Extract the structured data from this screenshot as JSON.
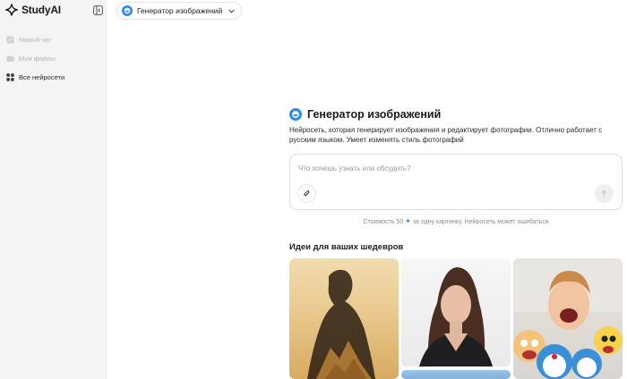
{
  "app": {
    "name": "StudyAI"
  },
  "sidebar": {
    "items": [
      {
        "label": "Новый чат",
        "icon": "edit-icon",
        "state": "disabled"
      },
      {
        "label": "Мои файлы",
        "icon": "folder-icon",
        "state": "disabled"
      },
      {
        "label": "Все нейросети",
        "icon": "grid-icon",
        "state": "active"
      }
    ]
  },
  "model_selector": {
    "label": "Генератор изображений",
    "icon": "image-generator-icon"
  },
  "main": {
    "title": "Генератор изображений",
    "description": "Нейросеть, которая генерирует изображения и редактирует фотографии. Отлично работает с русским языком. Умеет изменять стиль фотографий",
    "input": {
      "placeholder": "Что хочешь узнать или обсудить?"
    },
    "note_before": "Стоимость 50",
    "note_after": "за одну картинку. Нейросеть может ошибаться",
    "ideas_title": "Идеи для ваших шедевров"
  },
  "colors": {
    "accent": "#2c8cf0",
    "sidebar_bg": "#f4f4f4",
    "muted_text": "#b4b4b4"
  }
}
